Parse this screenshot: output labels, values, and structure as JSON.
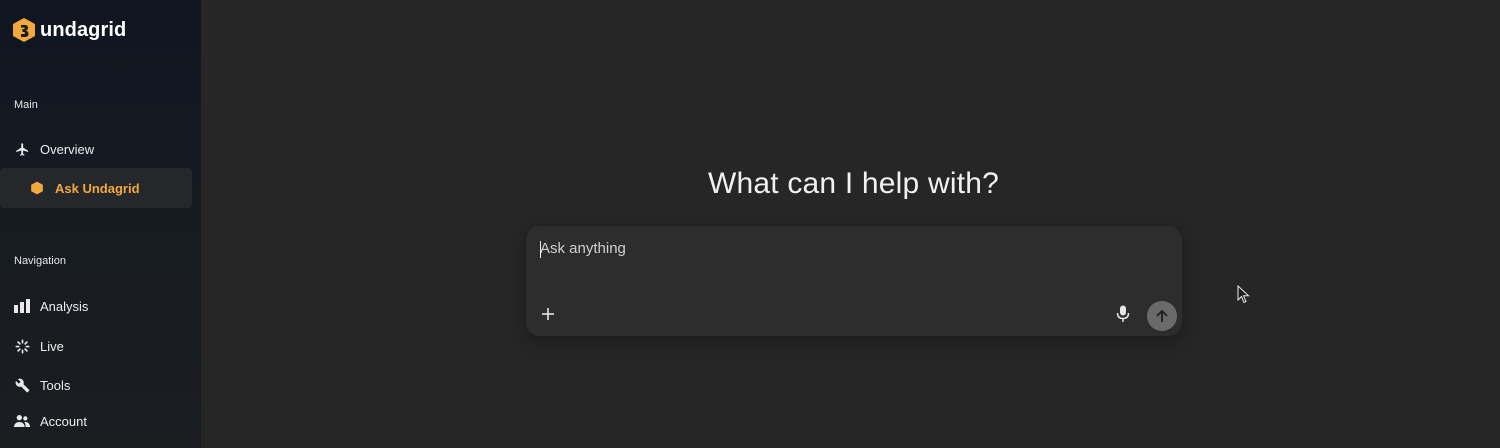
{
  "brand": {
    "name": "undagrid",
    "logo_icon": "undagrid-hexagon-logo",
    "accent_color": "#f2a93b"
  },
  "sidebar": {
    "sections": [
      {
        "label": "Main",
        "items": [
          {
            "label": "Overview",
            "icon": "airplane-icon",
            "active": false
          },
          {
            "label": "Ask Undagrid",
            "icon": "hexagon-icon",
            "active": true
          }
        ]
      },
      {
        "label": "Navigation",
        "items": [
          {
            "label": "Analysis",
            "icon": "bar-chart-icon",
            "active": false
          },
          {
            "label": "Live",
            "icon": "live-spinner-icon",
            "active": false
          },
          {
            "label": "Tools",
            "icon": "wrench-icon",
            "active": false
          },
          {
            "label": "Account",
            "icon": "people-icon",
            "active": false
          }
        ]
      }
    ]
  },
  "main": {
    "headline": "What can I help with?",
    "composer": {
      "placeholder": "Ask anything",
      "value": "",
      "attach_icon": "plus-icon",
      "voice_icon": "microphone-icon",
      "send_icon": "arrow-up-icon"
    }
  },
  "colors": {
    "background": "#262626",
    "sidebar_top": "#0f1620",
    "composer_bg": "#2d2d2d",
    "send_button": "#6a6a6a"
  }
}
